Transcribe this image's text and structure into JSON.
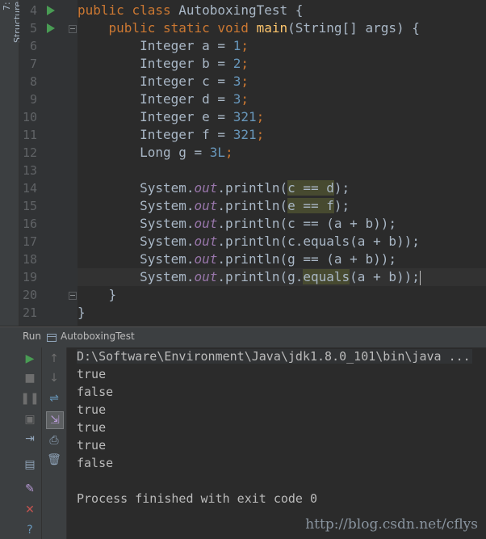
{
  "structure_tab": "7: Structure",
  "editor": {
    "line_numbers": [
      "4",
      "5",
      "6",
      "7",
      "8",
      "9",
      "10",
      "11",
      "12",
      "13",
      "14",
      "15",
      "16",
      "17",
      "18",
      "19",
      "20",
      "21"
    ]
  },
  "code": {
    "line4": {
      "kw1": "public",
      "kw2": "class",
      "name": "AutoboxingTest",
      "brace": "{"
    },
    "line5": {
      "kw1": "public",
      "kw2": "static",
      "kw3": "void",
      "method": "main",
      "rest": "(String[] args) {"
    },
    "decls": [
      {
        "type": "Integer",
        "name": "a",
        "value": "1"
      },
      {
        "type": "Integer",
        "name": "b",
        "value": "2"
      },
      {
        "type": "Integer",
        "name": "c",
        "value": "3"
      },
      {
        "type": "Integer",
        "name": "d",
        "value": "3"
      },
      {
        "type": "Integer",
        "name": "e",
        "value": "321"
      },
      {
        "type": "Integer",
        "name": "f",
        "value": "321"
      },
      {
        "type": "Long",
        "name": "g",
        "value": "3L"
      }
    ],
    "prints": [
      {
        "sys": "System.",
        "out": "out",
        "call": ".println(",
        "arg": "c == d",
        "end": ");"
      },
      {
        "sys": "System.",
        "out": "out",
        "call": ".println(",
        "arg": "e == f",
        "end": ");"
      },
      {
        "sys": "System.",
        "out": "out",
        "call": ".println(",
        "arg": "c == (a + b)",
        "end": ");"
      },
      {
        "sys": "System.",
        "out": "out",
        "call": ".println(",
        "arg": "c.equals(a + b)",
        "end": ");"
      },
      {
        "sys": "System.",
        "out": "out",
        "call": ".println(",
        "arg": "g == (a + b)",
        "end": ");"
      },
      {
        "sys": "System.",
        "out": "out",
        "call": ".println(",
        "pre": "g.",
        "hl": "equals",
        "post": "(a + b)",
        "end": ");"
      }
    ],
    "close_method": "}",
    "close_class": "}"
  },
  "run_panel": {
    "label": "Run",
    "config_name": "AutoboxingTest",
    "command": "D:\\Software\\Environment\\Java\\jdk1.8.0_101\\bin\\java ...",
    "output": [
      "true",
      "false",
      "true",
      "true",
      "true",
      "false"
    ],
    "exit_message": "Process finished with exit code 0"
  },
  "watermark": "http://blog.csdn.net/cflys",
  "colors": {
    "background": "#2b2b2b",
    "keyword": "#cc7832",
    "number": "#6897bb",
    "method": "#ffc66d",
    "static_field": "#9876aa",
    "run_green": "#499c54",
    "stop_red": "#c75450"
  }
}
